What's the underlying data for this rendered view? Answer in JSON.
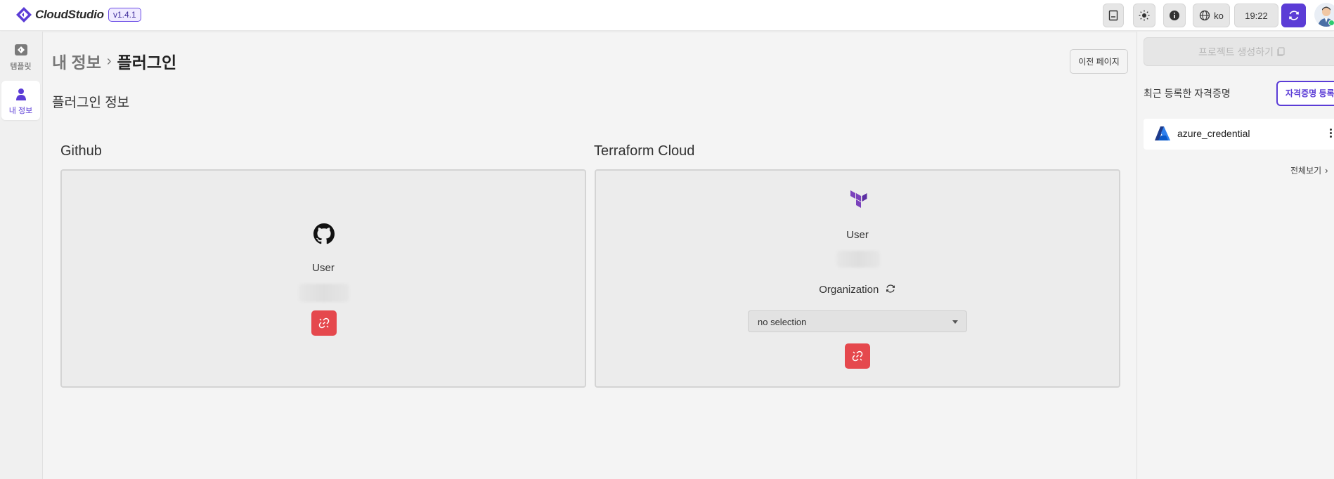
{
  "app": {
    "brand": "CloudStudio",
    "version": "v1.4.1",
    "accent_color": "#5b3cd6"
  },
  "topbar": {
    "language": "ko",
    "clock": "19:22",
    "icons": [
      "notebook-icon",
      "sun-icon",
      "info-icon",
      "globe-icon",
      "sync-icon"
    ]
  },
  "leftnav": {
    "items": [
      {
        "label": "템플릿",
        "icon": "template-icon",
        "active": false
      },
      {
        "label": "내 정보",
        "icon": "person-icon",
        "active": true
      }
    ]
  },
  "main": {
    "breadcrumb": {
      "parent": "내 정보",
      "current": "플러그인"
    },
    "back_button": "이전 페이지",
    "section_title": "플러그인 정보",
    "github": {
      "title": "Github",
      "user_label": "User",
      "icon": "github-icon"
    },
    "terraform": {
      "title": "Terraform Cloud",
      "user_label": "User",
      "organization_label": "Organization",
      "organization_select": "no selection",
      "icon": "terraform-icon"
    },
    "unlink_color": "#e5484d"
  },
  "rightpanel": {
    "create_project": "프로젝트 생성하기",
    "recent_title": "최근 등록한 자격증명",
    "register_button": "자격증명 등록",
    "credentials": [
      {
        "name": "azure_credential",
        "icon": "azure-icon"
      }
    ],
    "view_all": "전체보기"
  }
}
